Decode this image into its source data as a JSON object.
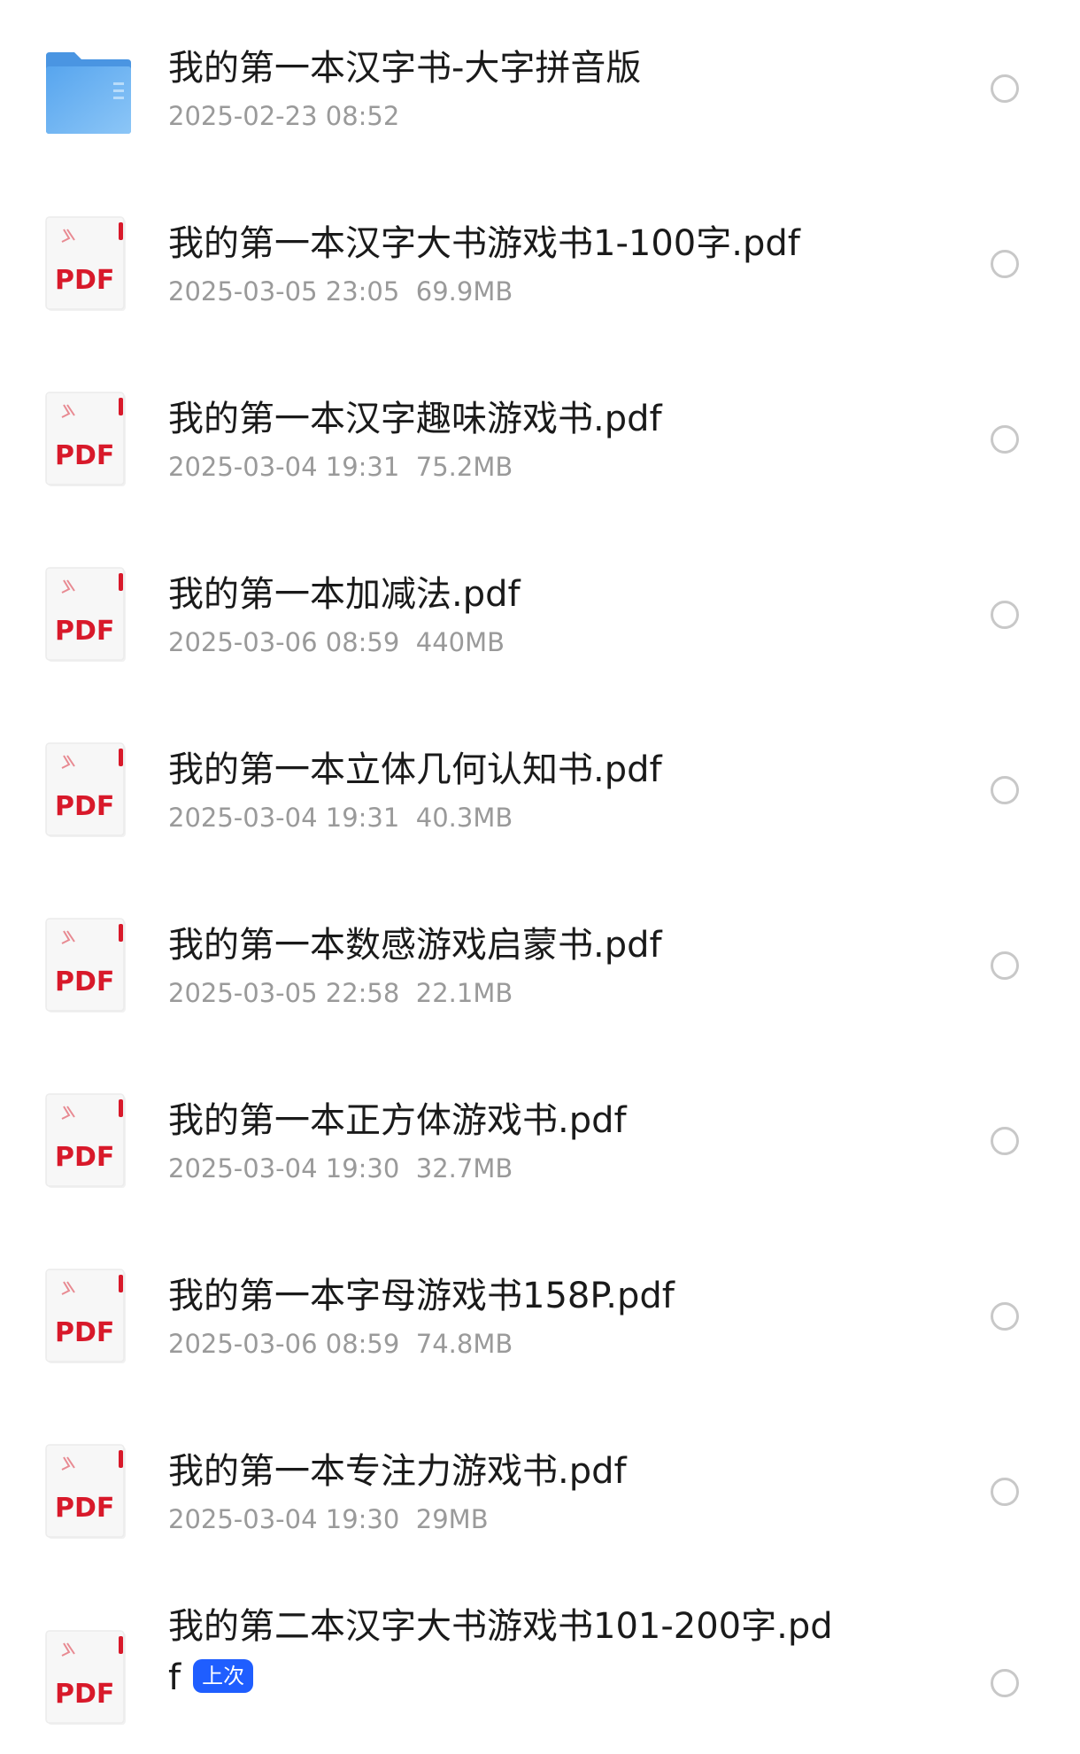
{
  "files": [
    {
      "type": "folder",
      "icon": "folder-icon",
      "name": "我的第一本汉字书-大字拼音版",
      "date": "2025-02-23 08:52",
      "size": ""
    },
    {
      "type": "pdf",
      "icon": "pdf-file-icon",
      "icon_label": "PDF",
      "name": "我的第一本汉字大书游戏书1-100字.pdf",
      "date": "2025-03-05 23:05",
      "size": "69.9MB"
    },
    {
      "type": "pdf",
      "icon": "pdf-file-icon",
      "icon_label": "PDF",
      "name": "我的第一本汉字趣味游戏书.pdf",
      "date": "2025-03-04 19:31",
      "size": "75.2MB"
    },
    {
      "type": "pdf",
      "icon": "pdf-file-icon",
      "icon_label": "PDF",
      "name": "我的第一本加减法.pdf",
      "date": "2025-03-06 08:59",
      "size": "440MB"
    },
    {
      "type": "pdf",
      "icon": "pdf-file-icon",
      "icon_label": "PDF",
      "name": "我的第一本立体几何认知书.pdf",
      "date": "2025-03-04 19:31",
      "size": "40.3MB"
    },
    {
      "type": "pdf",
      "icon": "pdf-file-icon",
      "icon_label": "PDF",
      "name": "我的第一本数感游戏启蒙书.pdf",
      "date": "2025-03-05 22:58",
      "size": "22.1MB"
    },
    {
      "type": "pdf",
      "icon": "pdf-file-icon",
      "icon_label": "PDF",
      "name": "我的第一本正方体游戏书.pdf",
      "date": "2025-03-04 19:30",
      "size": "32.7MB"
    },
    {
      "type": "pdf",
      "icon": "pdf-file-icon",
      "icon_label": "PDF",
      "name": "我的第一本字母游戏书158P.pdf",
      "date": "2025-03-06 08:59",
      "size": "74.8MB"
    },
    {
      "type": "pdf",
      "icon": "pdf-file-icon",
      "icon_label": "PDF",
      "name": "我的第一本专注力游戏书.pdf",
      "date": "2025-03-04 19:30",
      "size": "29MB"
    },
    {
      "type": "pdf",
      "icon": "pdf-file-icon",
      "icon_label": "PDF",
      "name": "我的第二本汉字大书游戏书101-200字.pdf",
      "badge": "上次",
      "date": "",
      "size": ""
    }
  ],
  "colors": {
    "pdf_red": "#d8192a",
    "folder_blue": "#5aaaf0",
    "badge_blue": "#1f5eff",
    "meta_gray": "#9a9a9a"
  }
}
